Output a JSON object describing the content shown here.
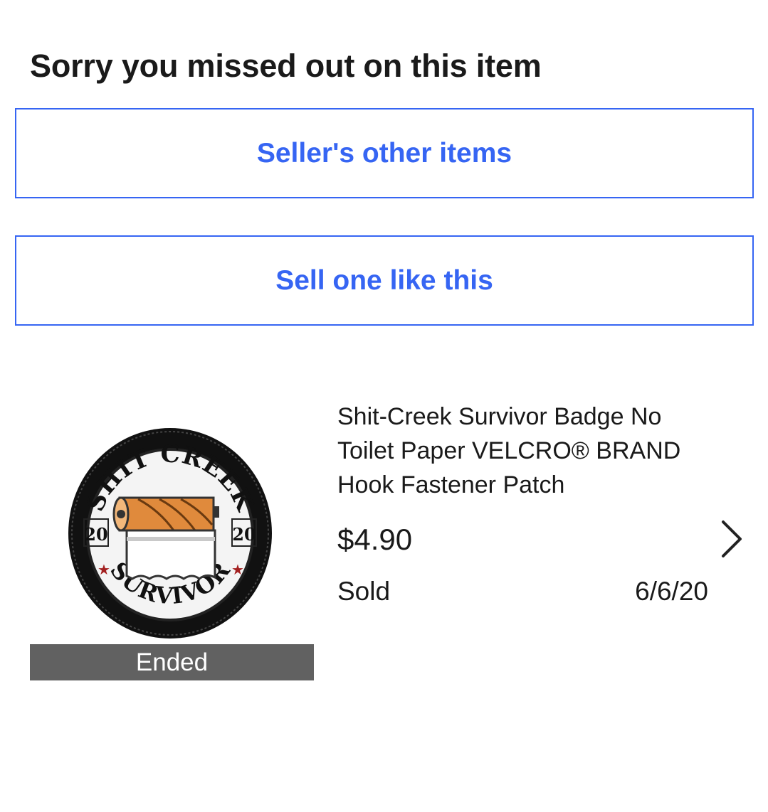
{
  "page": {
    "title": "Sorry you missed out on this item"
  },
  "actions": {
    "sellers_other_items": "Seller's other items",
    "sell_one_like_this": "Sell one like this"
  },
  "item": {
    "title": "Shit-Creek Survivor Badge No Toilet Paper VELCRO® BRAND Hook Fastener Patch",
    "price": "$4.90",
    "status": "Sold",
    "date": "6/6/20",
    "badge": "Ended",
    "image": {
      "icon": "toilet-paper-patch-image",
      "top_text": "SHIT CREEK",
      "bottom_text": "SURVIVOR",
      "year_left": "20",
      "year_right": "20"
    }
  },
  "colors": {
    "accent": "#3665f3",
    "ended_bar": "#616161",
    "text": "#1a1a1a"
  }
}
